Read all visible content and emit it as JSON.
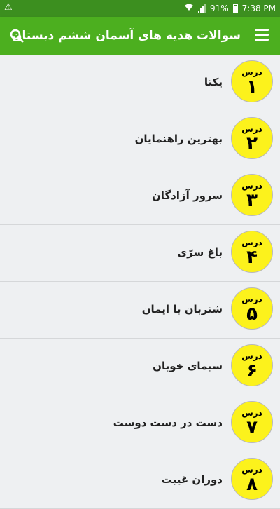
{
  "status_bar": {
    "battery": "91%",
    "time": "7:38 PM",
    "icons": [
      "warning-icon",
      "wifi-icon",
      "signal-icon",
      "battery-icon"
    ]
  },
  "app_bar": {
    "title": "سوالات هدیه های آسمان ششم دبستان",
    "icons": [
      "search-icon",
      "menu-icon"
    ]
  },
  "colors": {
    "status_bar": "#3c8f1f",
    "app_bar": "#4caf1f",
    "badge": "#fcf21c",
    "background": "#eef0f2"
  },
  "lessons": [
    {
      "badge_label": "درس",
      "number": "۱",
      "title": "یکتا"
    },
    {
      "badge_label": "درس",
      "number": "۲",
      "title": "بهترین راهنمایان"
    },
    {
      "badge_label": "درس",
      "number": "۳",
      "title": "سرور آزادگان"
    },
    {
      "badge_label": "درس",
      "number": "۴",
      "title": "باغ سرّی"
    },
    {
      "badge_label": "درس",
      "number": "۵",
      "title": "شتربان با ایمان"
    },
    {
      "badge_label": "درس",
      "number": "۶",
      "title": "سیمای خوبان"
    },
    {
      "badge_label": "درس",
      "number": "۷",
      "title": "دست در دست دوست"
    },
    {
      "badge_label": "درس",
      "number": "۸",
      "title": "دوران غیبت"
    }
  ]
}
